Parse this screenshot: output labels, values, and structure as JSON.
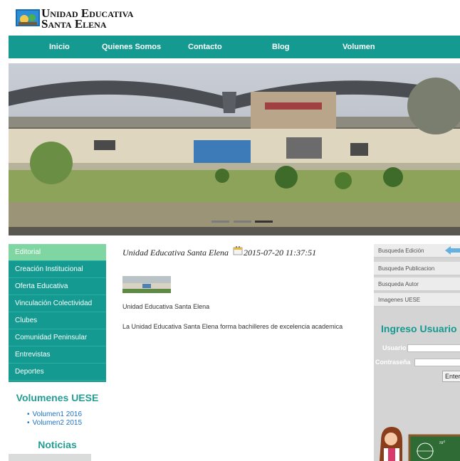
{
  "header": {
    "logo_line1": "Unidad Educativa",
    "logo_line2": "Santa Elena"
  },
  "nav": {
    "items": [
      "Inicio",
      "Quienes Somos",
      "Contacto",
      "Blog",
      "Volumen"
    ]
  },
  "sidebar": {
    "menu": [
      "Editorial",
      "Creación Institucional",
      "Oferta Educativa",
      "Vinculación Colectividad",
      "Clubes",
      "Comunidad Peninsular",
      "Entrevistas",
      "Deportes"
    ],
    "volumes_title": "Volumenes UESE",
    "volumes": [
      "Volumen1 2016",
      "Volumen2 2015"
    ],
    "news_title": "Noticias"
  },
  "post": {
    "title": "Unidad Educativa Santa Elena",
    "date": "2015-07-20 11:37:51",
    "subtitle": "Unidad Educativa Santa Elena",
    "description": "La Unidad Educativa Santa Elena forma bachilleres de excelencia academica"
  },
  "right": {
    "items": [
      "Busqueda Edición",
      "Busqueda Publicacion",
      "Busqueda Autor",
      "Imagenes UESE"
    ],
    "login_title": "Ingreso Usuario",
    "user_label": "Usuario",
    "pass_label": "Contraseña",
    "enter_label": "Enter"
  },
  "colors": {
    "accent": "#149a90",
    "active": "#7fd6a3",
    "link": "#1f72c4"
  }
}
